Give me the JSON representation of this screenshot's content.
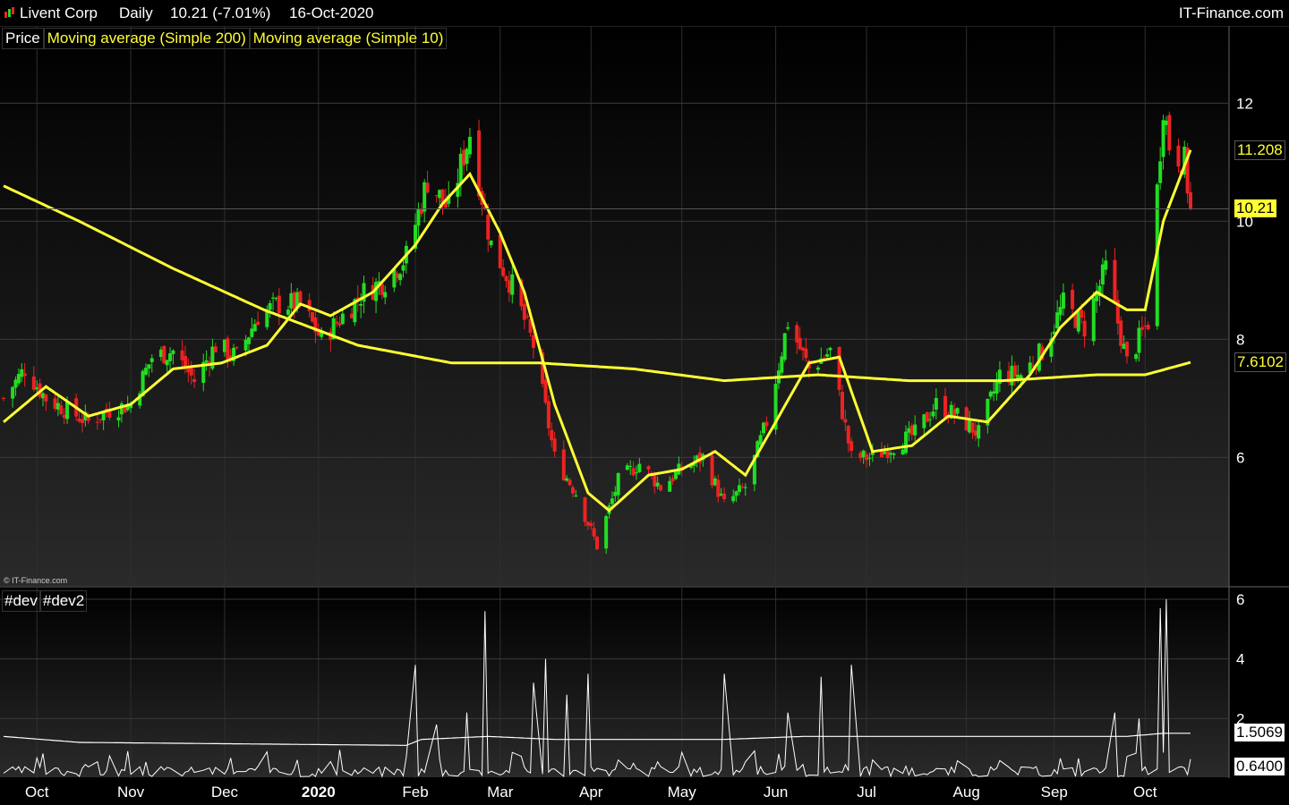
{
  "header": {
    "symbol": "Livent Corp",
    "period": "Daily",
    "quote": "10.21 (-7.01%)",
    "date": "16-Oct-2020",
    "site": "IT-Finance.com"
  },
  "legend": {
    "price": "Price",
    "ma200": "Moving average (Simple 200)",
    "ma10": "Moving average (Simple 10)"
  },
  "indicator_legend": {
    "dev": "#dev",
    "dev2": "#dev2"
  },
  "copyright": "© IT-Finance.com",
  "colors": {
    "up": "#22dd22",
    "down": "#ee2222",
    "ma": "#ffff33",
    "dev": "#ffffff",
    "bg": "#000000"
  },
  "value_tags": {
    "ma10": "11.208",
    "last": "10.21",
    "ma200": "7.6102",
    "dev2": "1.5069",
    "dev": "0.6400"
  },
  "chart_data": [
    {
      "type": "candlestick",
      "y_ticks": [
        6,
        8,
        10,
        12
      ],
      "ylim": [
        3.9,
        12.9
      ],
      "x_labels": [
        "Oct",
        "Nov",
        "Dec",
        "2020",
        "Feb",
        "Mar",
        "Apr",
        "May",
        "Jun",
        "Jul",
        "Aug",
        "Sep",
        "Oct"
      ],
      "x_label_dates": [
        "2019-10-01",
        "2019-11-01",
        "2019-12-02",
        "2020-01-02",
        "2020-02-03",
        "2020-03-02",
        "2020-04-01",
        "2020-05-01",
        "2020-06-01",
        "2020-07-01",
        "2020-08-03",
        "2020-09-01",
        "2020-10-01"
      ],
      "date_range": [
        "2019-09-20",
        "2020-10-16"
      ],
      "close_anchors": [
        {
          "date": "2019-09-20",
          "close": 7.0
        },
        {
          "date": "2019-09-27",
          "close": 7.5
        },
        {
          "date": "2019-10-04",
          "close": 7.0
        },
        {
          "date": "2019-10-11",
          "close": 6.8
        },
        {
          "date": "2019-10-18",
          "close": 6.6
        },
        {
          "date": "2019-10-25",
          "close": 6.8
        },
        {
          "date": "2019-11-01",
          "close": 6.9
        },
        {
          "date": "2019-11-08",
          "close": 7.7
        },
        {
          "date": "2019-11-15",
          "close": 7.8
        },
        {
          "date": "2019-11-22",
          "close": 7.3
        },
        {
          "date": "2019-11-29",
          "close": 7.9
        },
        {
          "date": "2019-12-06",
          "close": 7.7
        },
        {
          "date": "2019-12-13",
          "close": 8.4
        },
        {
          "date": "2019-12-20",
          "close": 8.6
        },
        {
          "date": "2019-12-27",
          "close": 8.6
        },
        {
          "date": "2020-01-03",
          "close": 8.0
        },
        {
          "date": "2020-01-10",
          "close": 8.4
        },
        {
          "date": "2020-01-17",
          "close": 8.8
        },
        {
          "date": "2020-01-24",
          "close": 9.0
        },
        {
          "date": "2020-01-31",
          "close": 9.4
        },
        {
          "date": "2020-02-07",
          "close": 10.7
        },
        {
          "date": "2020-02-14",
          "close": 10.2
        },
        {
          "date": "2020-02-21",
          "close": 11.5
        },
        {
          "date": "2020-02-28",
          "close": 9.6
        },
        {
          "date": "2020-03-06",
          "close": 8.9
        },
        {
          "date": "2020-03-13",
          "close": 7.9
        },
        {
          "date": "2020-03-20",
          "close": 6.0
        },
        {
          "date": "2020-03-27",
          "close": 5.4
        },
        {
          "date": "2020-04-03",
          "close": 4.5
        },
        {
          "date": "2020-04-10",
          "close": 5.6
        },
        {
          "date": "2020-04-17",
          "close": 5.9
        },
        {
          "date": "2020-04-24",
          "close": 5.5
        },
        {
          "date": "2020-05-01",
          "close": 5.8
        },
        {
          "date": "2020-05-08",
          "close": 6.0
        },
        {
          "date": "2020-05-15",
          "close": 5.2
        },
        {
          "date": "2020-05-22",
          "close": 5.5
        },
        {
          "date": "2020-05-29",
          "close": 6.6
        },
        {
          "date": "2020-06-05",
          "close": 8.3
        },
        {
          "date": "2020-06-12",
          "close": 7.5
        },
        {
          "date": "2020-06-19",
          "close": 7.8
        },
        {
          "date": "2020-06-26",
          "close": 6.0
        },
        {
          "date": "2020-07-03",
          "close": 6.0
        },
        {
          "date": "2020-07-10",
          "close": 6.2
        },
        {
          "date": "2020-07-17",
          "close": 6.4
        },
        {
          "date": "2020-07-24",
          "close": 6.9
        },
        {
          "date": "2020-07-31",
          "close": 6.7
        },
        {
          "date": "2020-08-07",
          "close": 6.4
        },
        {
          "date": "2020-08-14",
          "close": 7.4
        },
        {
          "date": "2020-08-21",
          "close": 7.4
        },
        {
          "date": "2020-08-28",
          "close": 7.8
        },
        {
          "date": "2020-09-04",
          "close": 8.6
        },
        {
          "date": "2020-09-11",
          "close": 8.2
        },
        {
          "date": "2020-09-18",
          "close": 9.2
        },
        {
          "date": "2020-09-25",
          "close": 7.6
        },
        {
          "date": "2020-10-02",
          "close": 8.3
        },
        {
          "date": "2020-10-07",
          "close": 12.0
        },
        {
          "date": "2020-10-09",
          "close": 11.3
        },
        {
          "date": "2020-10-14",
          "close": 11.0
        },
        {
          "date": "2020-10-16",
          "close": 10.21
        }
      ],
      "ma10_anchors": [
        {
          "date": "2019-09-20",
          "value": 6.6
        },
        {
          "date": "2019-10-04",
          "value": 7.2
        },
        {
          "date": "2019-10-18",
          "value": 6.7
        },
        {
          "date": "2019-11-01",
          "value": 6.9
        },
        {
          "date": "2019-11-15",
          "value": 7.5
        },
        {
          "date": "2019-12-01",
          "value": 7.6
        },
        {
          "date": "2019-12-16",
          "value": 7.9
        },
        {
          "date": "2019-12-27",
          "value": 8.6
        },
        {
          "date": "2020-01-06",
          "value": 8.4
        },
        {
          "date": "2020-01-20",
          "value": 8.8
        },
        {
          "date": "2020-02-03",
          "value": 9.6
        },
        {
          "date": "2020-02-12",
          "value": 10.3
        },
        {
          "date": "2020-02-21",
          "value": 10.8
        },
        {
          "date": "2020-03-02",
          "value": 9.8
        },
        {
          "date": "2020-03-10",
          "value": 8.8
        },
        {
          "date": "2020-03-20",
          "value": 6.9
        },
        {
          "date": "2020-03-31",
          "value": 5.4
        },
        {
          "date": "2020-04-07",
          "value": 5.1
        },
        {
          "date": "2020-04-20",
          "value": 5.7
        },
        {
          "date": "2020-05-01",
          "value": 5.8
        },
        {
          "date": "2020-05-12",
          "value": 6.1
        },
        {
          "date": "2020-05-22",
          "value": 5.7
        },
        {
          "date": "2020-06-01",
          "value": 6.6
        },
        {
          "date": "2020-06-12",
          "value": 7.6
        },
        {
          "date": "2020-06-22",
          "value": 7.7
        },
        {
          "date": "2020-07-03",
          "value": 6.1
        },
        {
          "date": "2020-07-16",
          "value": 6.2
        },
        {
          "date": "2020-07-28",
          "value": 6.7
        },
        {
          "date": "2020-08-10",
          "value": 6.6
        },
        {
          "date": "2020-08-24",
          "value": 7.4
        },
        {
          "date": "2020-09-03",
          "value": 8.2
        },
        {
          "date": "2020-09-15",
          "value": 8.8
        },
        {
          "date": "2020-09-25",
          "value": 8.5
        },
        {
          "date": "2020-10-01",
          "value": 8.5
        },
        {
          "date": "2020-10-07",
          "value": 10.0
        },
        {
          "date": "2020-10-16",
          "value": 11.208
        }
      ],
      "ma200_anchors": [
        {
          "date": "2019-09-20",
          "value": 10.6
        },
        {
          "date": "2019-10-15",
          "value": 10.0
        },
        {
          "date": "2019-11-15",
          "value": 9.2
        },
        {
          "date": "2019-12-15",
          "value": 8.5
        },
        {
          "date": "2020-01-15",
          "value": 7.9
        },
        {
          "date": "2020-02-15",
          "value": 7.6
        },
        {
          "date": "2020-03-15",
          "value": 7.6
        },
        {
          "date": "2020-04-15",
          "value": 7.5
        },
        {
          "date": "2020-05-15",
          "value": 7.3
        },
        {
          "date": "2020-06-15",
          "value": 7.4
        },
        {
          "date": "2020-07-15",
          "value": 7.3
        },
        {
          "date": "2020-08-15",
          "value": 7.3
        },
        {
          "date": "2020-09-15",
          "value": 7.4
        },
        {
          "date": "2020-10-01",
          "value": 7.4
        },
        {
          "date": "2020-10-16",
          "value": 7.6102
        }
      ],
      "last_value": 10.21,
      "ma10_last": 11.208,
      "ma200_last": 7.6102
    },
    {
      "type": "line",
      "name": "#dev / #dev2",
      "y_ticks": [
        2,
        4,
        6
      ],
      "ylim": [
        0,
        6.3
      ],
      "dev_spikes": [
        {
          "date": "2020-02-03",
          "value": 3.8
        },
        {
          "date": "2020-02-10",
          "value": 1.8
        },
        {
          "date": "2020-02-20",
          "value": 2.2
        },
        {
          "date": "2020-02-26",
          "value": 5.6
        },
        {
          "date": "2020-03-13",
          "value": 3.2
        },
        {
          "date": "2020-03-17",
          "value": 4.0
        },
        {
          "date": "2020-03-24",
          "value": 2.8
        },
        {
          "date": "2020-03-31",
          "value": 3.5
        },
        {
          "date": "2020-05-15",
          "value": 3.5
        },
        {
          "date": "2020-06-05",
          "value": 2.2
        },
        {
          "date": "2020-06-16",
          "value": 3.4
        },
        {
          "date": "2020-06-26",
          "value": 3.8
        },
        {
          "date": "2020-09-21",
          "value": 2.2
        },
        {
          "date": "2020-09-29",
          "value": 2.0
        },
        {
          "date": "2020-10-06",
          "value": 5.7
        },
        {
          "date": "2020-10-08",
          "value": 6.0
        }
      ],
      "dev2_anchors": [
        {
          "date": "2019-09-20",
          "value": 1.4
        },
        {
          "date": "2019-10-15",
          "value": 1.2
        },
        {
          "date": "2020-01-31",
          "value": 1.1
        },
        {
          "date": "2020-02-05",
          "value": 1.3
        },
        {
          "date": "2020-02-27",
          "value": 1.4
        },
        {
          "date": "2020-03-20",
          "value": 1.3
        },
        {
          "date": "2020-05-15",
          "value": 1.3
        },
        {
          "date": "2020-06-10",
          "value": 1.4
        },
        {
          "date": "2020-09-25",
          "value": 1.4
        },
        {
          "date": "2020-10-07",
          "value": 1.5069
        },
        {
          "date": "2020-10-16",
          "value": 1.5069
        }
      ],
      "dev_last": 0.64,
      "dev2_last": 1.5069
    }
  ]
}
